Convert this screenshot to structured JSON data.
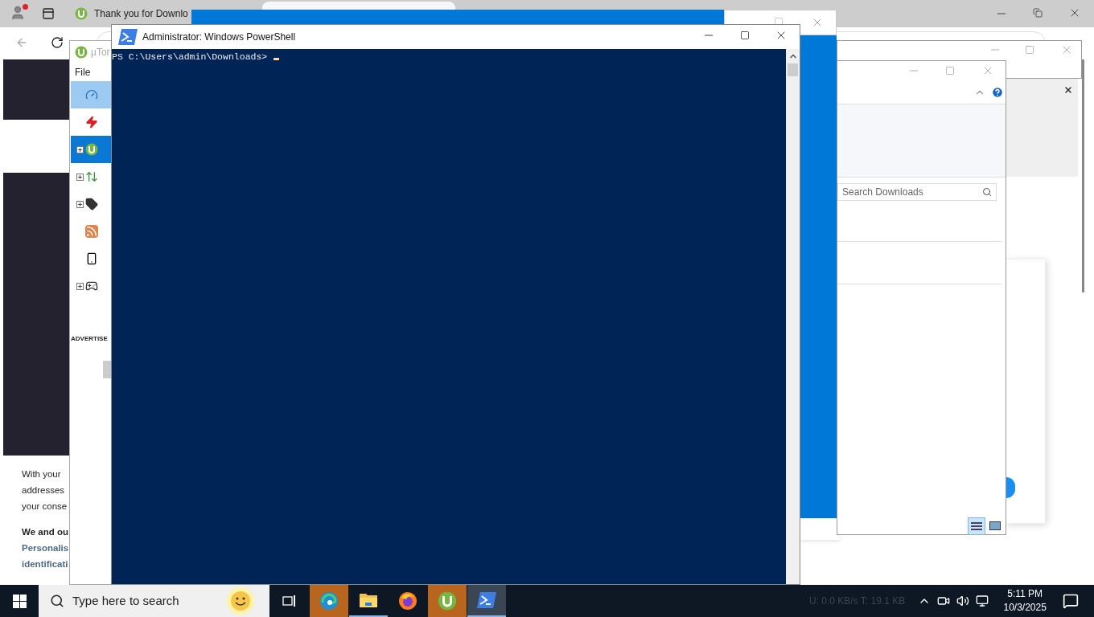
{
  "browser": {
    "tab_title": "Thank you for Downlo",
    "page_lines": [
      {
        "text": "With your",
        "kind": "plain"
      },
      {
        "text": "addresses",
        "kind": "plain"
      },
      {
        "text": "your conse",
        "kind": "plain"
      },
      {
        "text": "We and ou",
        "kind": "bold"
      },
      {
        "text": "Personalis",
        "kind": "link"
      },
      {
        "text": "identificati",
        "kind": "link"
      }
    ]
  },
  "utorrent": {
    "title": "µTor",
    "menu": [
      "File"
    ],
    "sidebar": [
      {
        "kind": "speed",
        "expandable": false,
        "selected": false,
        "hovered": true
      },
      {
        "kind": "bolt",
        "expandable": false,
        "selected": false,
        "hovered": false
      },
      {
        "kind": "torrent",
        "expandable": true,
        "selected": true,
        "hovered": false
      },
      {
        "kind": "transfer",
        "expandable": true,
        "selected": false,
        "hovered": false
      },
      {
        "kind": "label",
        "expandable": true,
        "selected": false,
        "hovered": false
      },
      {
        "kind": "feed",
        "expandable": false,
        "selected": false,
        "hovered": false
      },
      {
        "kind": "device",
        "expandable": false,
        "selected": false,
        "hovered": false
      },
      {
        "kind": "game",
        "expandable": true,
        "selected": false,
        "hovered": false
      }
    ],
    "ad_label": "ADVERTISE"
  },
  "powershell": {
    "title": "Administrator: Windows PowerShell",
    "prompt": "PS C:\\Users\\admin\\Downloads>"
  },
  "explorer": {
    "search_placeholder": "Search Downloads"
  },
  "taskbar": {
    "search_placeholder": "Type here to search",
    "apps": [
      {
        "kind": "edge",
        "flashing": true,
        "open": false,
        "active": false
      },
      {
        "kind": "files",
        "flashing": false,
        "open": true,
        "active": false
      },
      {
        "kind": "firefox",
        "flashing": false,
        "open": false,
        "active": false
      },
      {
        "kind": "utorrent",
        "flashing": true,
        "open": false,
        "active": false
      },
      {
        "kind": "powershell",
        "flashing": false,
        "open": true,
        "active": true
      }
    ],
    "status_text": "U: 0.0 KB/s T: 19.1 KB",
    "time": "5:11 PM",
    "date": "10/3/2025"
  }
}
